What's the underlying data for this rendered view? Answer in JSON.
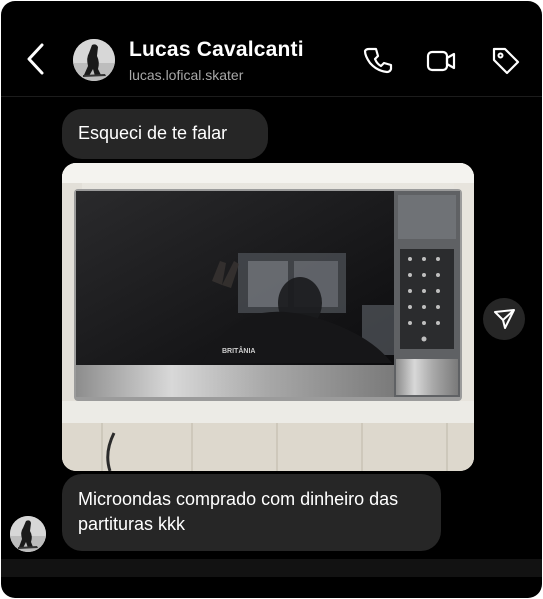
{
  "header": {
    "contact_name": "Lucas Cavalcanti",
    "username": "lucas.lofical.skater",
    "icons": [
      "back-chevron-icon",
      "phone-icon",
      "video-camera-icon",
      "tag-icon"
    ]
  },
  "messages": [
    {
      "type": "text",
      "text": "Esqueci de te falar"
    },
    {
      "type": "image",
      "description_icon": "microwave-photo",
      "brand_text": "BRITÂNIA"
    },
    {
      "type": "text",
      "text": "Microondas comprado com dinheiro das partituras kkk"
    }
  ],
  "colors": {
    "background": "#000000",
    "bubble": "#262626",
    "secondary_text": "#a8a8a8"
  }
}
